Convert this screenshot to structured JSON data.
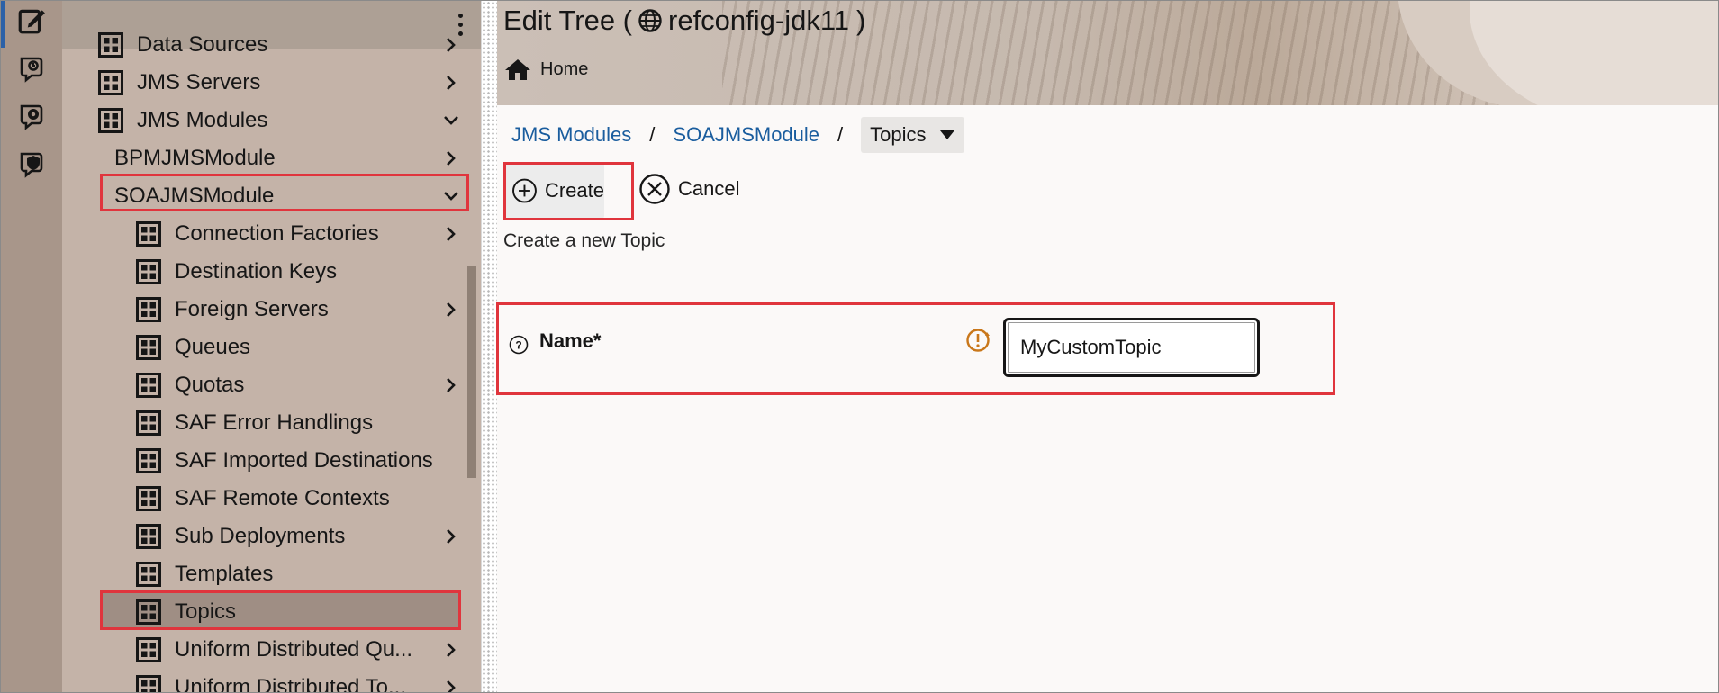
{
  "header": {
    "title_prefix": "Edit Tree (",
    "title_name": "refconfig-jdk11",
    "title_suffix": ")",
    "home_label": "Home"
  },
  "rail": {
    "items": [
      {
        "icon": "edit-tree-icon",
        "active": true
      },
      {
        "icon": "monitoring-icon",
        "active": false
      },
      {
        "icon": "configuration-view-icon",
        "active": false
      },
      {
        "icon": "security-icon",
        "active": false
      }
    ]
  },
  "nav": {
    "items": [
      {
        "label": "Data Sources",
        "level": 1,
        "expander": "right"
      },
      {
        "label": "JMS Servers",
        "level": 1,
        "expander": "right"
      },
      {
        "label": "JMS Modules",
        "level": 1,
        "expander": "down"
      },
      {
        "label": "BPMJMSModule",
        "level": 2,
        "expander": "right"
      },
      {
        "label": "SOAJMSModule",
        "level": 2,
        "expander": "down"
      },
      {
        "label": "Connection Factories",
        "level": 3,
        "expander": "right"
      },
      {
        "label": "Destination Keys",
        "level": 3,
        "expander": ""
      },
      {
        "label": "Foreign Servers",
        "level": 3,
        "expander": "right"
      },
      {
        "label": "Queues",
        "level": 3,
        "expander": ""
      },
      {
        "label": "Quotas",
        "level": 3,
        "expander": "right"
      },
      {
        "label": "SAF Error Handlings",
        "level": 3,
        "expander": ""
      },
      {
        "label": "SAF Imported Destinations",
        "level": 3,
        "expander": ""
      },
      {
        "label": "SAF Remote Contexts",
        "level": 3,
        "expander": ""
      },
      {
        "label": "Sub Deployments",
        "level": 3,
        "expander": "right"
      },
      {
        "label": "Templates",
        "level": 3,
        "expander": ""
      },
      {
        "label": "Topics",
        "level": 3,
        "expander": "",
        "selected": true
      },
      {
        "label": "Uniform Distributed Qu...",
        "level": 3,
        "expander": "right"
      },
      {
        "label": "Uniform Distributed To...",
        "level": 3,
        "expander": "right"
      }
    ]
  },
  "breadcrumb": {
    "items": [
      "JMS Modules",
      "SOAJMSModule"
    ],
    "separator": "/",
    "current": "Topics"
  },
  "toolbar": {
    "create_label": "Create",
    "cancel_label": "Cancel"
  },
  "form": {
    "description": "Create a new Topic",
    "name_label": "Name*",
    "name_value": "MyCustomTopic"
  },
  "colors": {
    "highlight": "#e0353d",
    "link": "#1a5d9e",
    "warning": "#c9771a"
  }
}
